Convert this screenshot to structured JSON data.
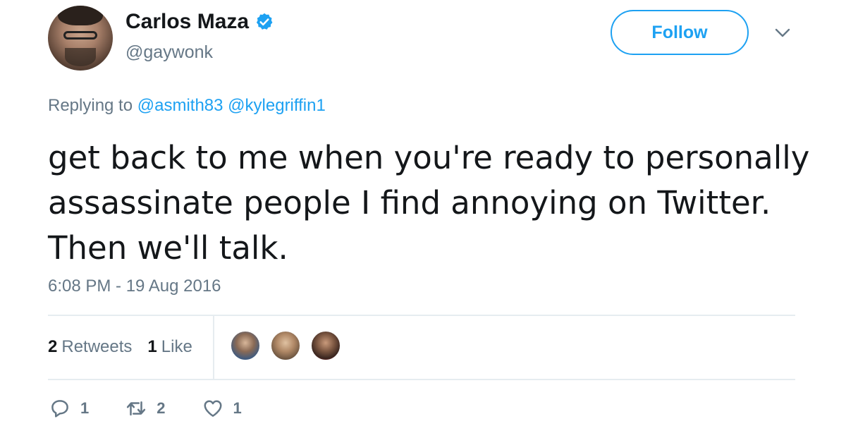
{
  "author": {
    "name": "Carlos Maza",
    "handle": "@gaywonk",
    "verified": true
  },
  "header": {
    "follow_label": "Follow"
  },
  "reply": {
    "prefix": "Replying to",
    "mentions": [
      "@asmith83",
      "@kylegriffin1"
    ]
  },
  "tweet": {
    "text": "get back to me when you're ready to personally assassinate people I find annoying on Twitter. Then we'll talk.",
    "timestamp": "6:08 PM - 19 Aug 2016"
  },
  "stats": {
    "retweets_count": "2",
    "retweets_label": "Retweets",
    "likes_count": "1",
    "likes_label": "Like"
  },
  "actions": {
    "reply_count": "1",
    "retweet_count": "2",
    "like_count": "1"
  },
  "icons": [
    "verified-badge-icon",
    "chevron-down-icon",
    "reply-icon",
    "retweet-icon",
    "heart-icon"
  ],
  "colors": {
    "accent": "#1da1f2",
    "secondary_text": "#657786",
    "primary_text": "#14171a",
    "divider": "#e6ecf0"
  }
}
